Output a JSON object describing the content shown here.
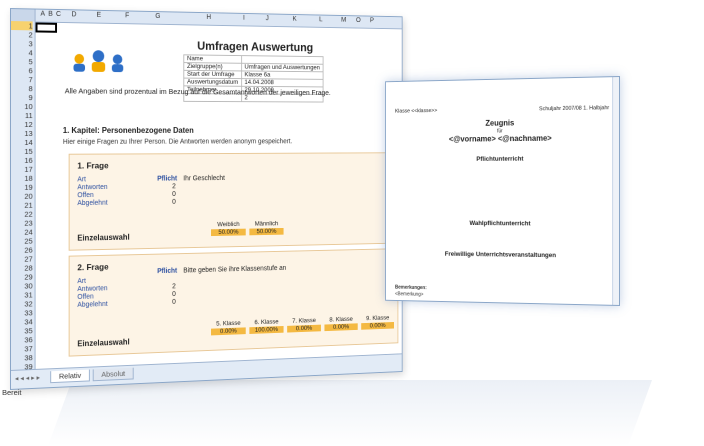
{
  "spreadsheet": {
    "columns": [
      "A",
      "B",
      "C",
      "D",
      "E",
      "F",
      "G",
      "H",
      "I",
      "J",
      "K",
      "L",
      "M",
      "O",
      "P"
    ],
    "rows": [
      "1",
      "2",
      "3",
      "4",
      "5",
      "6",
      "7",
      "8",
      "9",
      "10",
      "11",
      "12",
      "13",
      "14",
      "15",
      "16",
      "17",
      "18",
      "19",
      "20",
      "21",
      "22",
      "23",
      "24",
      "25",
      "26",
      "27",
      "28",
      "29",
      "30",
      "31",
      "32",
      "33",
      "34",
      "35",
      "36",
      "37",
      "38",
      "39"
    ],
    "title": "Umfragen Auswertung",
    "meta": [
      {
        "label": "Name",
        "value": ""
      },
      {
        "label": "Zielgruppe(n)",
        "value": "Umfragen und Auswertungen"
      },
      {
        "label": "Start der Umfrage",
        "value": "Klasse 6a"
      },
      {
        "label": "Auswertungsdatum",
        "value": "14.04.2008"
      },
      {
        "label": "Teilnehmer",
        "value": "29.10.2009"
      },
      {
        "label": "",
        "value": "2"
      }
    ],
    "note": "Alle Angaben sind prozentual im Bezug auf die Gesamtantworten der jeweiligen Frage.",
    "chapter": "1. Kapitel: Personenbezogene Daten",
    "intro": "Hier einige Fragen zu Ihrer Person. Die Antworten werden anonym gespeichert.",
    "frage1": {
      "title": "1. Frage",
      "pflicht": "Pflicht",
      "question": "Ihr Geschlecht",
      "art": "Art",
      "antworten": "Antworten",
      "antworten_val": "2",
      "offen": "Offen",
      "offen_val": "0",
      "abgelehnt": "Abgelehnt",
      "abgelehnt_val": "0",
      "type": "Einzelauswahl",
      "options": [
        {
          "label": "Weiblich",
          "pct": "50.00%"
        },
        {
          "label": "Männlich",
          "pct": "50.00%"
        }
      ]
    },
    "frage2": {
      "title": "2. Frage",
      "pflicht": "Pflicht",
      "question": "Bitte geben Sie ihre Klassenstufe an",
      "art": "Art",
      "antworten": "Antworten",
      "antworten_val": "2",
      "offen": "Offen",
      "offen_val": "0",
      "abgelehnt": "Abgelehnt",
      "abgelehnt_val": "0",
      "type": "Einzelauswahl",
      "options": [
        {
          "label": "5. Klasse",
          "pct": "0.00%"
        },
        {
          "label": "6. Klasse",
          "pct": "100.00%"
        },
        {
          "label": "7. Klasse",
          "pct": "0.00%"
        },
        {
          "label": "8. Klasse",
          "pct": "0.00%"
        },
        {
          "label": "9. Klasse",
          "pct": "0.00%"
        }
      ]
    },
    "tabs": [
      "Relativ",
      "Absolut"
    ],
    "status": "Bereit"
  },
  "document": {
    "klasse": "Klasse <<klasse>>",
    "schuljahr": "Schuljahr 2007/08   1. Halbjahr",
    "zeugnis": "Zeugnis",
    "fuer": "für",
    "name": "<@vorname> <@nachname>",
    "sections": [
      "Pflichtunterricht",
      "Wahlpflichtunterricht",
      "Freiwillige Unterrichtsveranstaltungen"
    ],
    "bemerkungen": "Bemerkungen:",
    "bemerkung_field": "<Bemerkung>"
  }
}
